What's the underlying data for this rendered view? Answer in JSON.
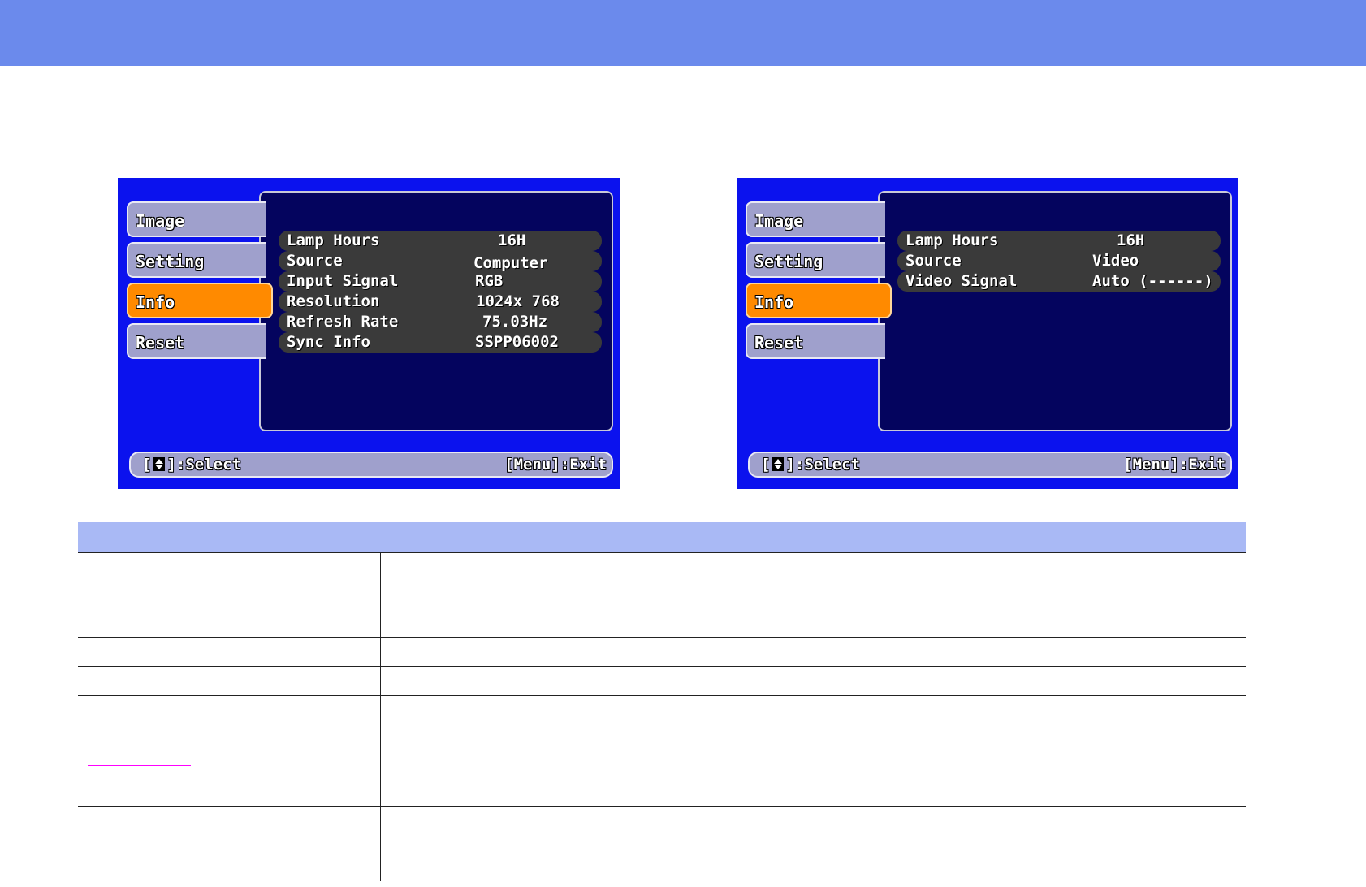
{
  "osd_left": {
    "tabs": {
      "image": "Image",
      "setting": "Setting",
      "info": "Info",
      "reset": "Reset"
    },
    "active_tab": "Info",
    "rows": [
      {
        "label": "Lamp Hours",
        "value": "16H"
      },
      {
        "label": "Source",
        "value": "Computer"
      },
      {
        "label": "Input Signal",
        "value": "RGB"
      },
      {
        "label": "Resolution",
        "value": "1024x 768"
      },
      {
        "label": "Refresh Rate",
        "value": "75.03Hz"
      },
      {
        "label": "Sync Info",
        "value": "SSPP06002"
      }
    ],
    "footer": {
      "select_prefix": "[",
      "select_suffix": "]:Select",
      "exit": "[Menu]:Exit"
    }
  },
  "osd_right": {
    "tabs": {
      "image": "Image",
      "setting": "Setting",
      "info": "Info",
      "reset": "Reset"
    },
    "active_tab": "Info",
    "rows": [
      {
        "label": "Lamp Hours",
        "value": "16H"
      },
      {
        "label": "Source",
        "value": "Video"
      },
      {
        "label": "Video Signal",
        "value": "Auto (------)"
      }
    ],
    "footer": {
      "select_prefix": "[",
      "select_suffix": "]:Select",
      "exit": "[Menu]:Exit"
    }
  },
  "colors": {
    "header_bar": "#6b8aec",
    "osd_background": "#0b12ee",
    "osd_panel": "#04045e",
    "tab_inactive": "#9fa0cc",
    "tab_active": "#ff8a00",
    "table_header": "#a9b9f5",
    "link": "#ff00ff"
  },
  "icons": {
    "select_arrow": "up-down-arrow-icon"
  },
  "table": {
    "columns": [
      "",
      ""
    ],
    "row_count": 7,
    "linked_row_index": 5
  }
}
